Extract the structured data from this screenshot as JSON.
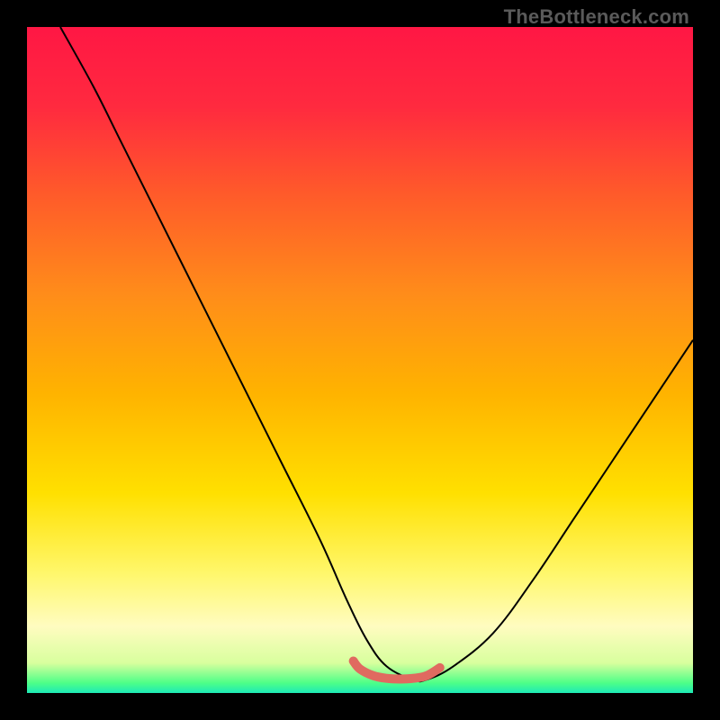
{
  "watermark": "TheBottleneck.com",
  "chart_data": {
    "type": "line",
    "title": "",
    "xlabel": "",
    "ylabel": "",
    "xlim": [
      0,
      100
    ],
    "ylim": [
      0,
      100
    ],
    "gradient_stops": [
      {
        "offset": 0.0,
        "color": "#ff1744"
      },
      {
        "offset": 0.12,
        "color": "#ff2a3f"
      },
      {
        "offset": 0.25,
        "color": "#ff5a2a"
      },
      {
        "offset": 0.4,
        "color": "#ff8c1a"
      },
      {
        "offset": 0.55,
        "color": "#ffb300"
      },
      {
        "offset": 0.7,
        "color": "#ffe000"
      },
      {
        "offset": 0.82,
        "color": "#fff76b"
      },
      {
        "offset": 0.9,
        "color": "#fffcc0"
      },
      {
        "offset": 0.955,
        "color": "#d8ff9e"
      },
      {
        "offset": 0.985,
        "color": "#4dff88"
      },
      {
        "offset": 1.0,
        "color": "#1de9b6"
      }
    ],
    "series": [
      {
        "name": "bottleneck-curve",
        "color": "#000000",
        "width": 2,
        "x": [
          5,
          10,
          14,
          20,
          26,
          32,
          38,
          44,
          48,
          51,
          54,
          58,
          60,
          64,
          70,
          76,
          82,
          88,
          94,
          100
        ],
        "y": [
          100,
          91,
          83,
          71,
          59,
          47,
          35,
          23,
          14,
          8,
          4,
          2,
          2,
          4,
          9,
          17,
          26,
          35,
          44,
          53
        ]
      },
      {
        "name": "flat-highlight",
        "color": "#e06a60",
        "width": 10,
        "linecap": "round",
        "x": [
          49,
          50,
          52,
          54,
          56,
          58,
          60,
          62
        ],
        "y": [
          4.8,
          3.6,
          2.6,
          2.2,
          2.1,
          2.2,
          2.6,
          3.8
        ]
      }
    ]
  }
}
